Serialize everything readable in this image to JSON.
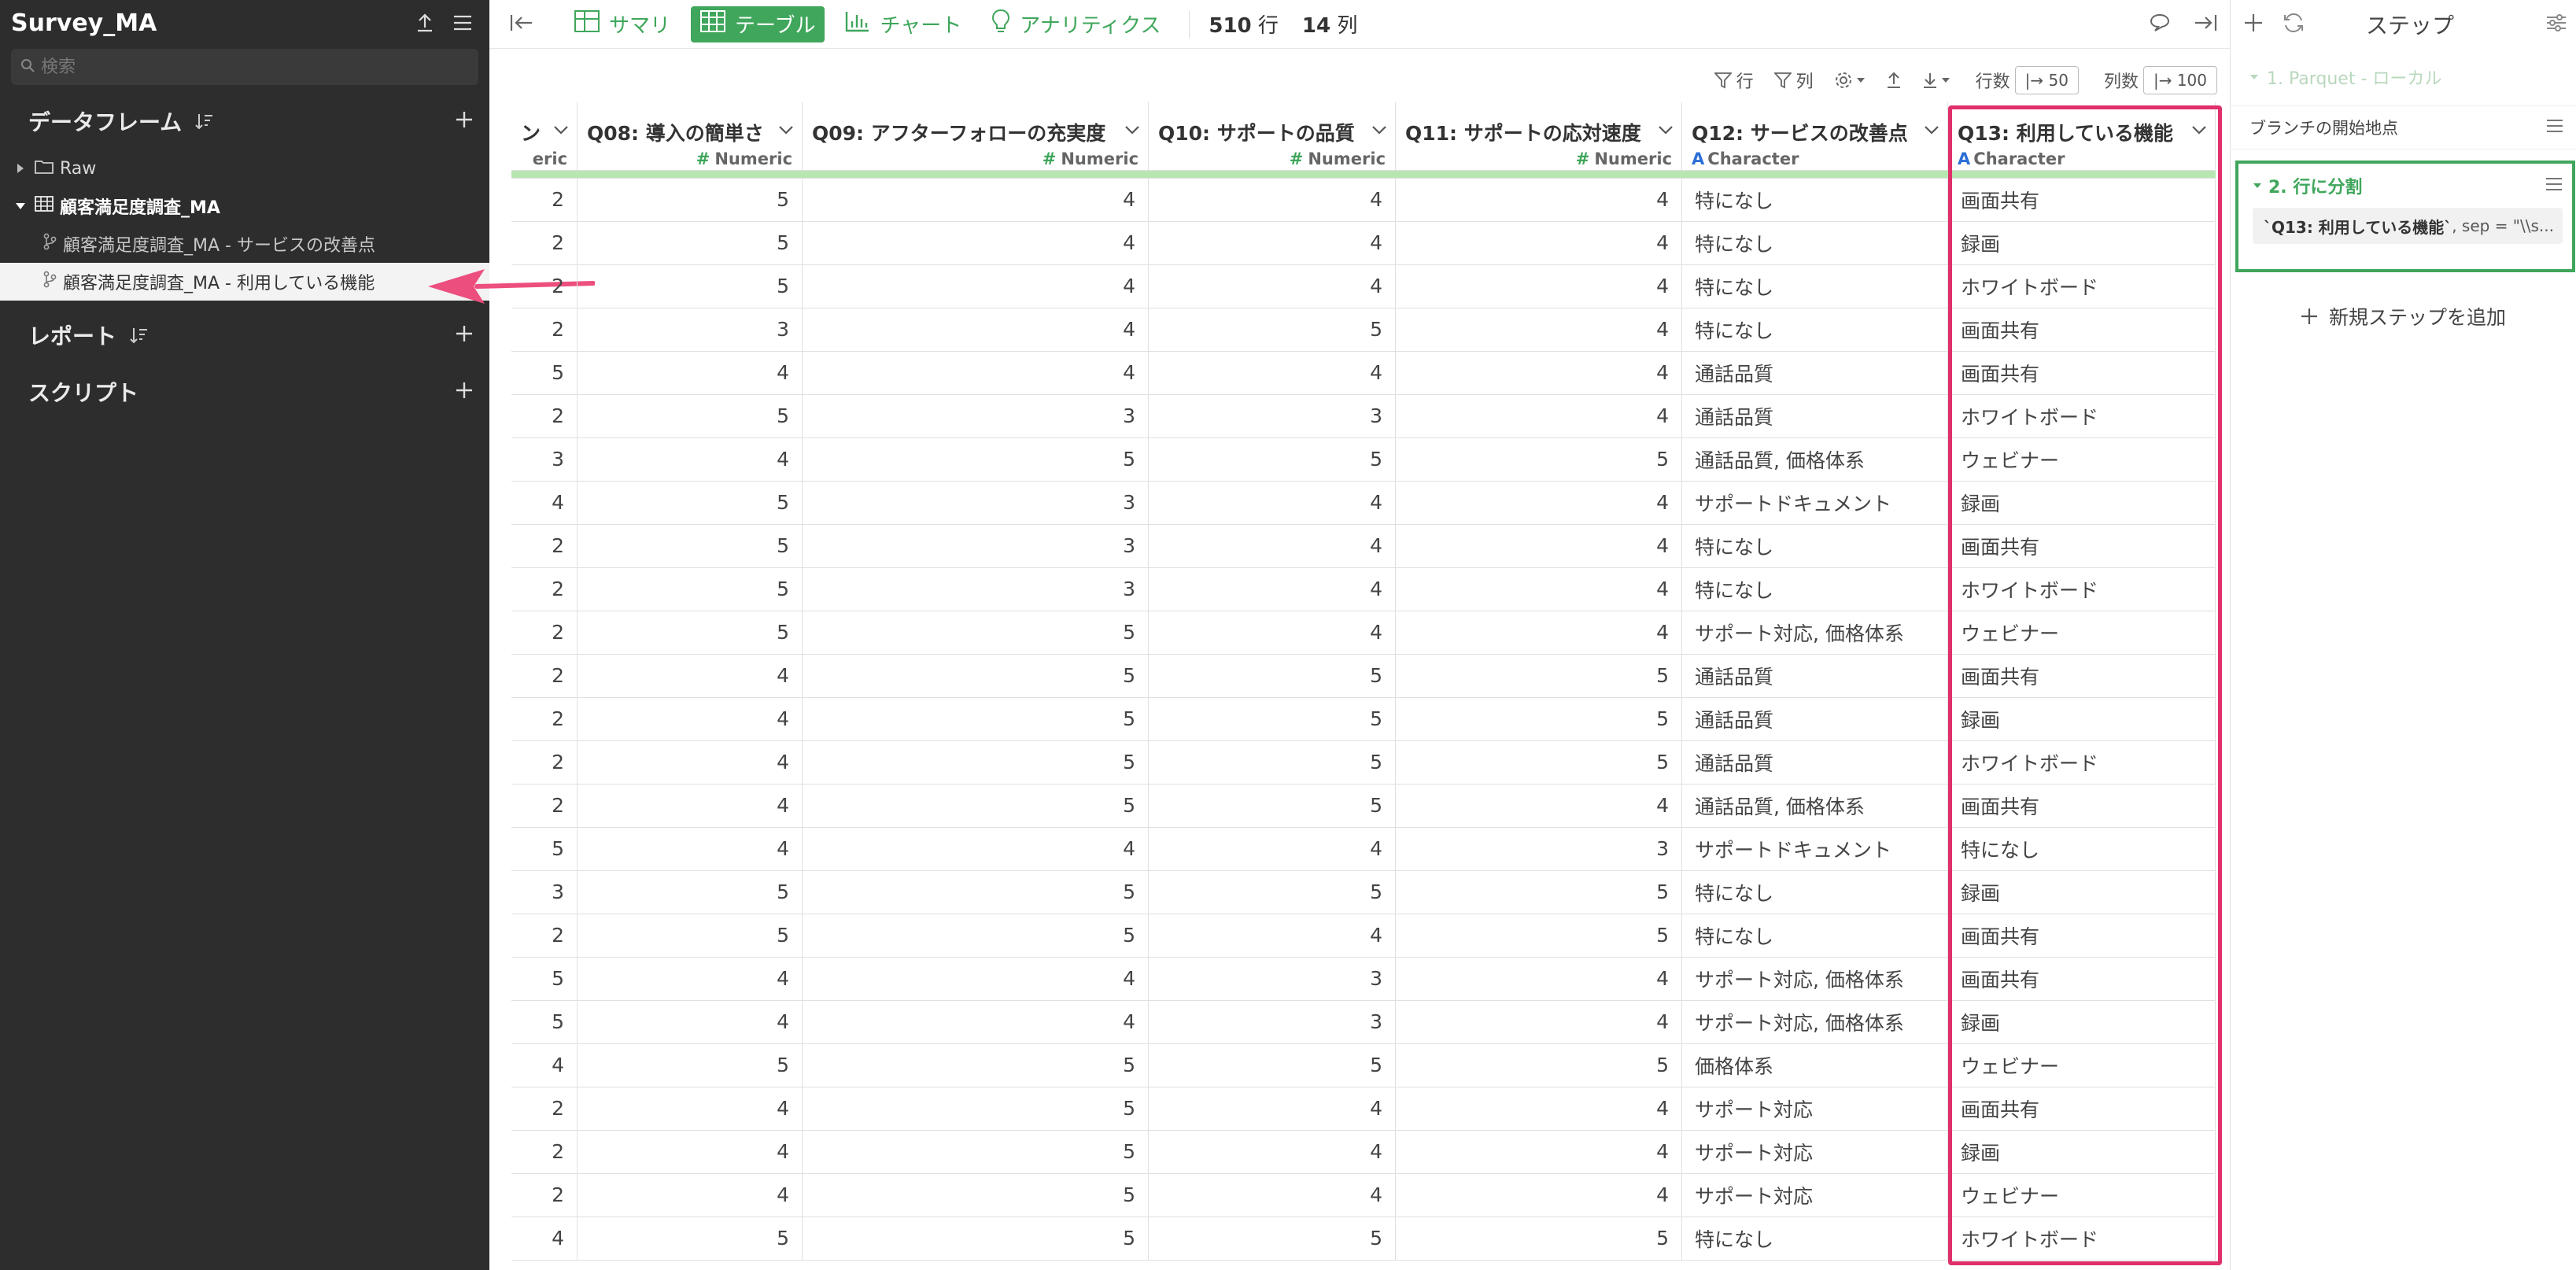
{
  "sidebar": {
    "title": "Survey_MA",
    "search_placeholder": "検索",
    "sections": {
      "dataframes": "データフレーム",
      "reports": "レポート",
      "scripts": "スクリプト"
    },
    "tree": [
      {
        "label": "Raw",
        "kind": "folder"
      },
      {
        "label": "顧客満足度調査_MA",
        "kind": "table"
      },
      {
        "label": "顧客満足度調査_MA - サービスの改善点",
        "kind": "branch"
      },
      {
        "label": "顧客満足度調査_MA - 利用している機能",
        "kind": "branch",
        "selected": true
      }
    ]
  },
  "toolbar": {
    "tabs": [
      "サマリ",
      "テーブル",
      "チャート",
      "アナリティクス"
    ],
    "active_tab": "テーブル",
    "rows_count": "510",
    "rows_unit": "行",
    "cols_count": "14",
    "cols_unit": "列"
  },
  "subbar": {
    "filter_rows": "行",
    "filter_cols": "列",
    "rows_label": "行数",
    "rows_value": "|→ 50",
    "cols_label": "列数",
    "cols_value": "|→ 100"
  },
  "table": {
    "columns": [
      {
        "name": "ン",
        "type": "eric",
        "kind": "num"
      },
      {
        "name": "Q08: 導入の簡単さ",
        "type": "Numeric",
        "kind": "num"
      },
      {
        "name": "Q09: アフターフォローの充実度",
        "type": "Numeric",
        "kind": "num"
      },
      {
        "name": "Q10: サポートの品質",
        "type": "Numeric",
        "kind": "num"
      },
      {
        "name": "Q11: サポートの応対速度",
        "type": "Numeric",
        "kind": "num"
      },
      {
        "name": "Q12: サービスの改善点",
        "type": "Character",
        "kind": "txt"
      },
      {
        "name": "Q13: 利用している機能",
        "type": "Character",
        "kind": "txt"
      }
    ],
    "rows": [
      [
        "2",
        "5",
        "4",
        "4",
        "4",
        "特になし",
        "画面共有"
      ],
      [
        "2",
        "5",
        "4",
        "4",
        "4",
        "特になし",
        "録画"
      ],
      [
        "2",
        "5",
        "4",
        "4",
        "4",
        "特になし",
        "ホワイトボード"
      ],
      [
        "2",
        "3",
        "4",
        "5",
        "4",
        "特になし",
        "画面共有"
      ],
      [
        "5",
        "4",
        "4",
        "4",
        "4",
        "通話品質",
        "画面共有"
      ],
      [
        "2",
        "5",
        "3",
        "3",
        "4",
        "通話品質",
        "ホワイトボード"
      ],
      [
        "3",
        "4",
        "5",
        "5",
        "5",
        "通話品質, 価格体系",
        "ウェビナー"
      ],
      [
        "4",
        "5",
        "3",
        "4",
        "4",
        "サポートドキュメント",
        "録画"
      ],
      [
        "2",
        "5",
        "3",
        "4",
        "4",
        "特になし",
        "画面共有"
      ],
      [
        "2",
        "5",
        "3",
        "4",
        "4",
        "特になし",
        "ホワイトボード"
      ],
      [
        "2",
        "5",
        "5",
        "4",
        "4",
        "サポート対応, 価格体系",
        "ウェビナー"
      ],
      [
        "2",
        "4",
        "5",
        "5",
        "5",
        "通話品質",
        "画面共有"
      ],
      [
        "2",
        "4",
        "5",
        "5",
        "5",
        "通話品質",
        "録画"
      ],
      [
        "2",
        "4",
        "5",
        "5",
        "5",
        "通話品質",
        "ホワイトボード"
      ],
      [
        "2",
        "4",
        "5",
        "5",
        "4",
        "通話品質, 価格体系",
        "画面共有"
      ],
      [
        "5",
        "4",
        "4",
        "4",
        "3",
        "サポートドキュメント",
        "特になし"
      ],
      [
        "3",
        "5",
        "5",
        "5",
        "5",
        "特になし",
        "録画"
      ],
      [
        "2",
        "5",
        "5",
        "4",
        "5",
        "特になし",
        "画面共有"
      ],
      [
        "5",
        "4",
        "4",
        "3",
        "4",
        "サポート対応, 価格体系",
        "画面共有"
      ],
      [
        "5",
        "4",
        "4",
        "3",
        "4",
        "サポート対応, 価格体系",
        "録画"
      ],
      [
        "4",
        "5",
        "5",
        "5",
        "5",
        "価格体系",
        "ウェビナー"
      ],
      [
        "2",
        "4",
        "5",
        "4",
        "4",
        "サポート対応",
        "画面共有"
      ],
      [
        "2",
        "4",
        "5",
        "4",
        "4",
        "サポート対応",
        "録画"
      ],
      [
        "2",
        "4",
        "5",
        "4",
        "4",
        "サポート対応",
        "ウェビナー"
      ],
      [
        "4",
        "5",
        "5",
        "5",
        "5",
        "特になし",
        "ホワイトボード"
      ]
    ]
  },
  "steps_panel": {
    "title": "ステップ",
    "step1": "1. Parquet - ローカル",
    "branch_start": "ブランチの開始地点",
    "step2": "2. 行に分割",
    "step2_code_bold": "`Q13: 利用している機能`",
    "step2_code_rest": ", sep = \"\\\\s...",
    "add_step": "新規ステップを追加"
  },
  "colors": {
    "accent": "#3fa65b",
    "highlight": "#e0306a",
    "sidebar_bg": "#2d2d2d"
  }
}
